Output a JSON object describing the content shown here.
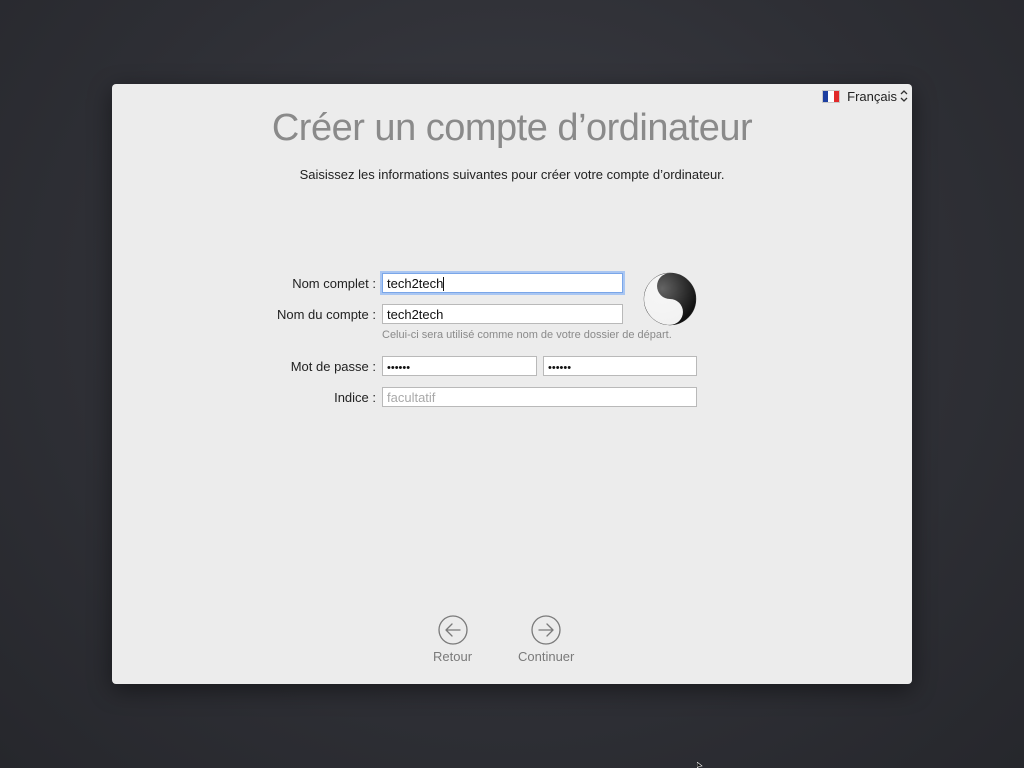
{
  "language": {
    "label": "Français",
    "flag_colors": [
      "#1d3fa0",
      "#ffffff",
      "#e12a2a"
    ]
  },
  "header": {
    "title": "Créer un compte d’ordinateur",
    "subtitle": "Saisissez les informations suivantes pour créer votre compte d’ordinateur."
  },
  "form": {
    "full_name": {
      "label": "Nom complet :",
      "value": "tech2tech"
    },
    "account_name": {
      "label": "Nom du compte :",
      "value": "tech2tech",
      "help": "Celui-ci sera utilisé comme nom de votre dossier de départ."
    },
    "password": {
      "label": "Mot de passe :",
      "value": "••••••",
      "verify_value": "••••••"
    },
    "hint": {
      "label": "Indice :",
      "placeholder": "facultatif"
    },
    "avatar_icon": "yin-yang-icon"
  },
  "nav": {
    "back_label": "Retour",
    "continue_label": "Continuer"
  },
  "colors": {
    "background": "#2e2f35",
    "window": "#ececec",
    "focus_ring": "#a9c6f2",
    "title": "#8a8a8a"
  }
}
